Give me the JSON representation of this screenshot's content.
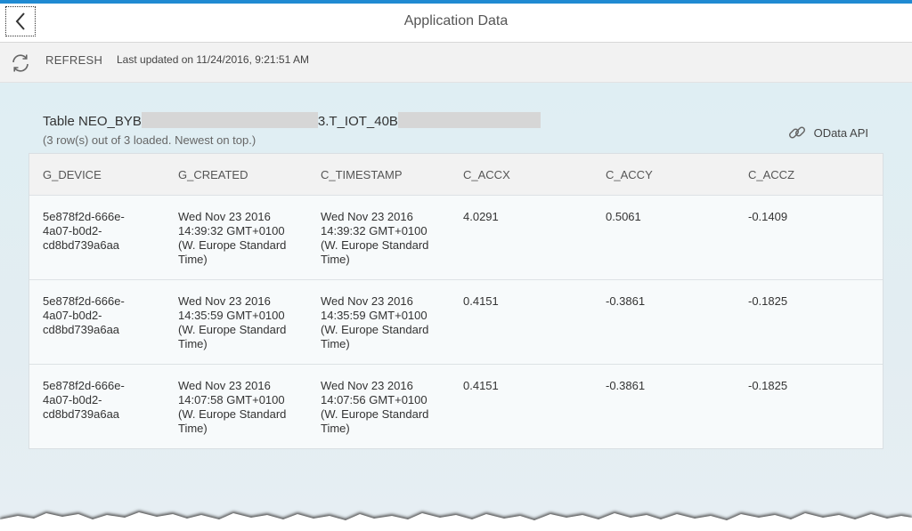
{
  "header": {
    "title": "Application Data"
  },
  "toolbar": {
    "refresh_label": "REFRESH",
    "last_updated": "Last updated on 11/24/2016, 9:21:51 AM"
  },
  "table_info": {
    "name_prefix": "Table NEO_BYB",
    "name_middle": "3.T_IOT_40B",
    "row_count": "(3 row(s) out of 3 loaded. Newest on top.)",
    "odata_label": "OData API"
  },
  "columns": [
    "G_DEVICE",
    "G_CREATED",
    "C_TIMESTAMP",
    "C_ACCX",
    "C_ACCY",
    "C_ACCZ"
  ],
  "rows": [
    {
      "g_device": "5e878f2d-666e-\n4a07-b0d2-\ncd8bd739a6aa",
      "g_created": "Wed Nov 23 2016\n14:39:32 GMT+0100\n(W. Europe Standard\nTime)",
      "c_timestamp": "Wed Nov 23 2016\n14:39:32 GMT+0100\n(W. Europe Standard\nTime)",
      "c_accx": "4.0291",
      "c_accy": "0.5061",
      "c_accz": "-0.1409"
    },
    {
      "g_device": "5e878f2d-666e-\n4a07-b0d2-\ncd8bd739a6aa",
      "g_created": "Wed Nov 23 2016\n14:35:59 GMT+0100\n(W. Europe Standard\nTime)",
      "c_timestamp": "Wed Nov 23 2016\n14:35:59 GMT+0100\n(W. Europe Standard\nTime)",
      "c_accx": "0.4151",
      "c_accy": "-0.3861",
      "c_accz": "-0.1825"
    },
    {
      "g_device": "5e878f2d-666e-\n4a07-b0d2-\ncd8bd739a6aa",
      "g_created": "Wed Nov 23 2016\n14:07:58 GMT+0100\n(W. Europe Standard\nTime)",
      "c_timestamp": "Wed Nov 23 2016\n14:07:56 GMT+0100\n(W. Europe Standard\nTime)",
      "c_accx": "0.4151",
      "c_accy": "-0.3861",
      "c_accz": "-0.1825"
    }
  ],
  "colors": {
    "accent": "#1f8ad2",
    "background": "#dfeef3"
  },
  "icons": {
    "back": "chevron-left-icon",
    "refresh": "refresh-icon",
    "odata": "link-icon"
  }
}
